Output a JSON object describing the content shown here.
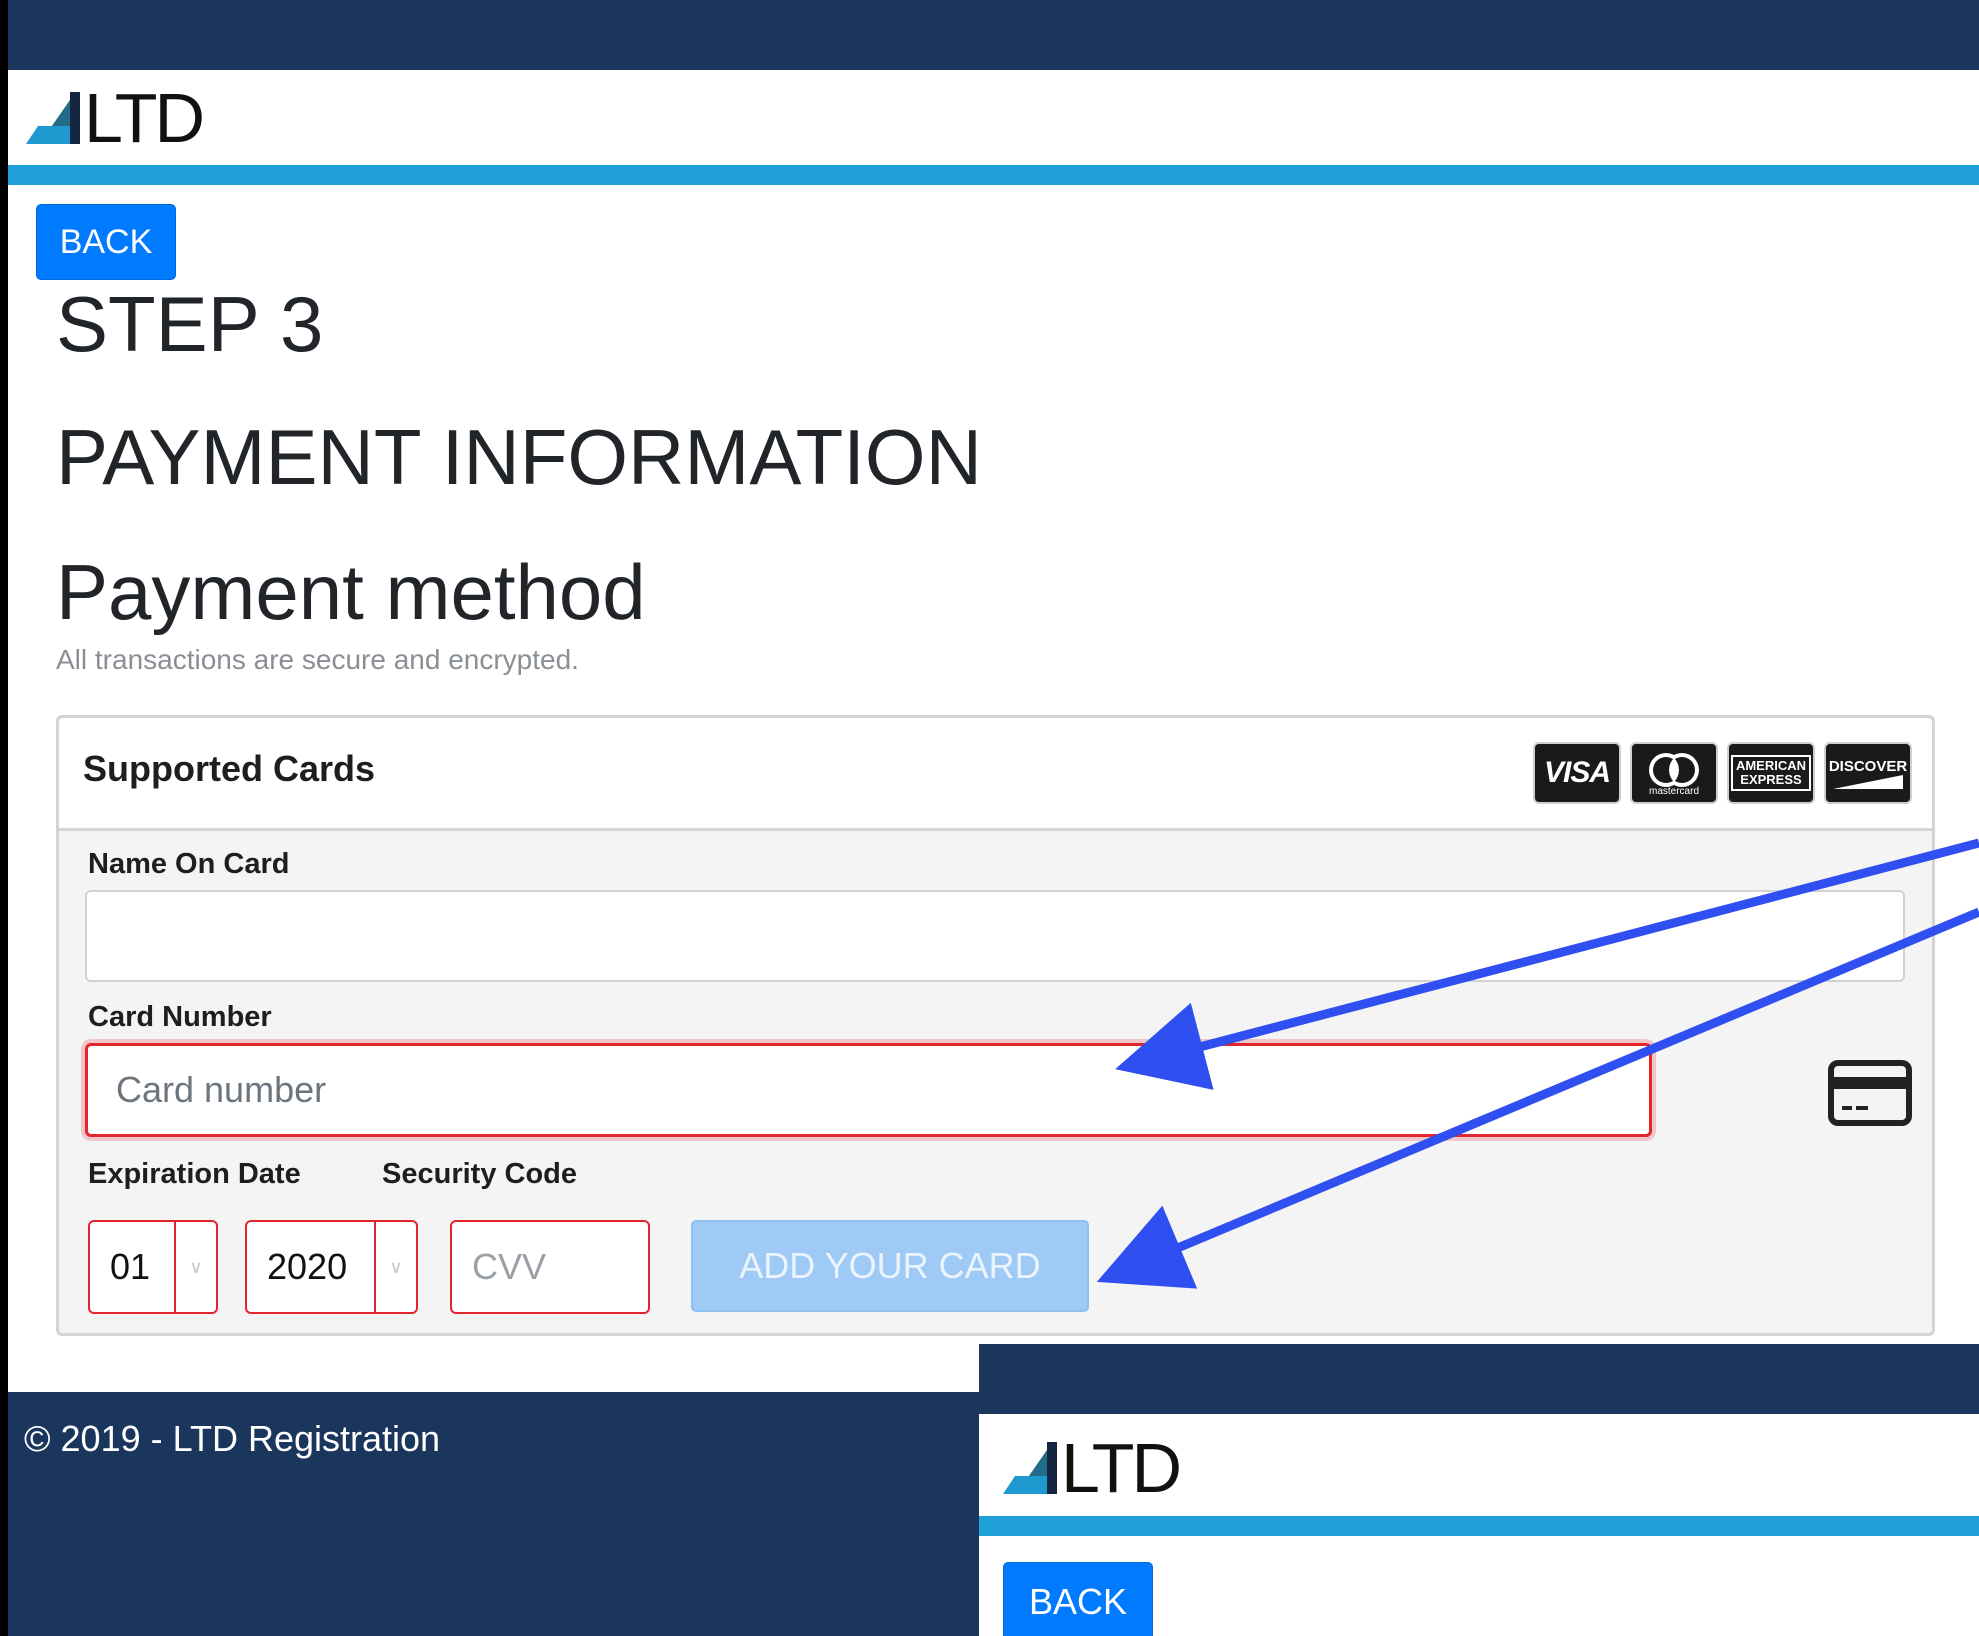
{
  "brand": {
    "logo_text": "LTD"
  },
  "nav": {
    "back_label": "BACK"
  },
  "headings": {
    "step": "STEP 3",
    "payment_information": "PAYMENT INFORMATION",
    "payment_method": "Payment method",
    "secure_note": "All transactions are secure and encrypted."
  },
  "panel": {
    "title": "Supported Cards",
    "card_brands": [
      {
        "name": "VISA",
        "icon": "visa-logo"
      },
      {
        "name": "mastercard",
        "icon": "mastercard-logo"
      },
      {
        "name": "AMERICAN EXPRESS",
        "icon": "amex-logo"
      },
      {
        "name": "DISCOVER",
        "icon": "discover-logo"
      }
    ]
  },
  "form": {
    "name_label": "Name On Card",
    "name_value": "",
    "card_label": "Card Number",
    "card_placeholder": "Card number",
    "card_icon": "credit-card-icon",
    "expiration_label": "Expiration Date",
    "security_label": "Security Code",
    "month_value": "01",
    "year_value": "2020",
    "cvv_placeholder": "CVV",
    "submit_label": "ADD YOUR CARD"
  },
  "footer": {
    "copyright": "© 2019 - LTD Registration"
  },
  "colors": {
    "navy": "#1b365d",
    "cyan_stripe": "#1fa0d8",
    "primary_blue": "#007bff",
    "disabled_blue": "#9fcaf5",
    "error_red": "#e3262e",
    "annotation_arrow": "#2f4ff0"
  }
}
